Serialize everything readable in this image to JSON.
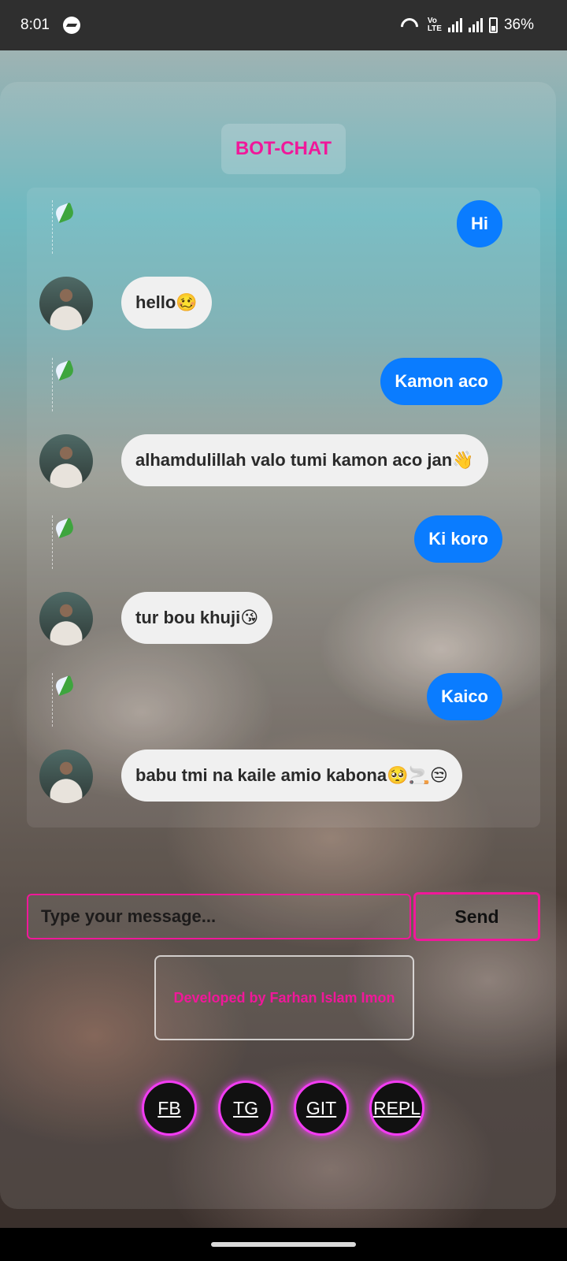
{
  "status_bar": {
    "time": "8:01",
    "volte": "Vo\nLTE",
    "battery": "36%"
  },
  "header": {
    "title": "BOT-CHAT"
  },
  "messages": [
    {
      "sender": "user",
      "text": "Hi"
    },
    {
      "sender": "bot",
      "text": "hello🥴"
    },
    {
      "sender": "user",
      "text": "Kamon aco"
    },
    {
      "sender": "bot",
      "text": "alhamdulillah valo tumi kamon aco jan👋"
    },
    {
      "sender": "user",
      "text": "Ki koro"
    },
    {
      "sender": "bot",
      "text": "tur bou khuji😘"
    },
    {
      "sender": "user",
      "text": "Kaico"
    },
    {
      "sender": "bot",
      "text": "babu tmi na kaile amio kabona🥺🚬😒"
    }
  ],
  "composer": {
    "placeholder": "Type your message...",
    "send_label": "Send"
  },
  "footer": {
    "developer": "Developed by Farhan Islam Imon",
    "links": [
      "FB",
      "TG",
      "GIT",
      "REPL"
    ]
  },
  "colors": {
    "accent": "#f0189a",
    "user_bubble": "#0a7cff",
    "bot_bubble": "#f0f0f0",
    "social_glow": "#f23cf2"
  }
}
